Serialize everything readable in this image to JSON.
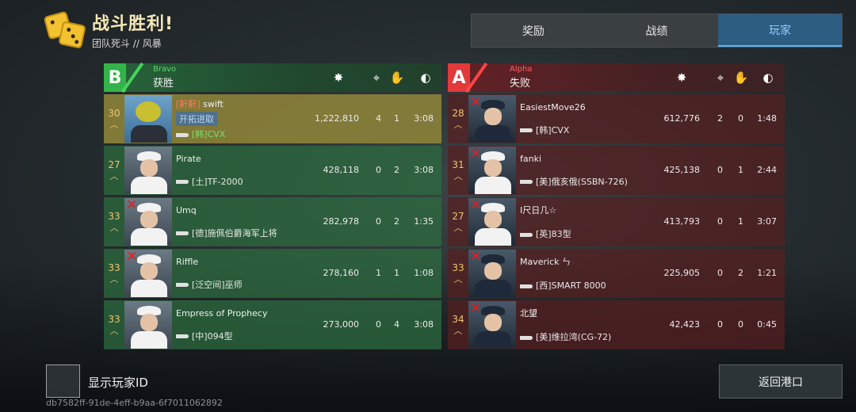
{
  "header": {
    "title": "战斗胜利!",
    "subtitle": "团队死斗 // 风暴"
  },
  "tabs": [
    {
      "label": "奖励",
      "active": false
    },
    {
      "label": "战绩",
      "active": false
    },
    {
      "label": "玩家",
      "active": true
    }
  ],
  "stat_icons": [
    "damage-icon",
    "crosshair-icon",
    "handshake-icon",
    "clock-icon"
  ],
  "bravo": {
    "letter": "B",
    "code": "Bravo",
    "result": "获胜",
    "players": [
      {
        "level": "30",
        "clan": "[鼾鼾]",
        "name": "swift",
        "tag": "开拓进取",
        "ship": "[韩]CVX",
        "damage": "1,222,810",
        "kills": "4",
        "assists": "1",
        "time": "3:08",
        "dead": false,
        "self": true,
        "portrait": "frog"
      },
      {
        "level": "27",
        "clan": "",
        "name": "Pirate",
        "tag": "",
        "ship": "[土]TF-2000",
        "damage": "428,118",
        "kills": "0",
        "assists": "2",
        "time": "3:08",
        "dead": false,
        "self": false,
        "portrait": "light"
      },
      {
        "level": "33",
        "clan": "",
        "name": "Umq",
        "tag": "",
        "ship": "[德]施佩伯爵海军上将",
        "damage": "282,978",
        "kills": "0",
        "assists": "2",
        "time": "1:35",
        "dead": true,
        "self": false,
        "portrait": "light"
      },
      {
        "level": "33",
        "clan": "",
        "name": "Riffle",
        "tag": "",
        "ship": "[泛空间]巫师",
        "damage": "278,160",
        "kills": "1",
        "assists": "1",
        "time": "1:08",
        "dead": true,
        "self": false,
        "portrait": "light"
      },
      {
        "level": "33",
        "clan": "",
        "name": "Empress of Prophecy",
        "tag": "",
        "ship": "[中]094型",
        "damage": "273,000",
        "kills": "0",
        "assists": "4",
        "time": "3:08",
        "dead": false,
        "self": false,
        "portrait": "light"
      }
    ]
  },
  "alpha": {
    "letter": "A",
    "code": "Alpha",
    "result": "失败",
    "players": [
      {
        "level": "28",
        "name": "EasiestMove26",
        "ship": "[韩]CVX",
        "damage": "612,776",
        "kills": "2",
        "assists": "0",
        "time": "1:48",
        "dead": true,
        "portrait": "dark"
      },
      {
        "level": "31",
        "name": "fanki",
        "ship": "[美]俄亥俄(SSBN-726)",
        "damage": "425,138",
        "kills": "0",
        "assists": "1",
        "time": "2:44",
        "dead": true,
        "portrait": "light"
      },
      {
        "level": "27",
        "name": "I尺日几☆",
        "ship": "[英]83型",
        "damage": "413,793",
        "kills": "0",
        "assists": "1",
        "time": "3:07",
        "dead": true,
        "portrait": "light"
      },
      {
        "level": "33",
        "name": "Maverick ㄣ",
        "ship": "[西]SMART 8000",
        "damage": "225,905",
        "kills": "0",
        "assists": "2",
        "time": "1:21",
        "dead": true,
        "portrait": "dark"
      },
      {
        "level": "34",
        "name": "北望",
        "ship": "[美]维拉湾(CG-72)",
        "damage": "42,423",
        "kills": "0",
        "assists": "0",
        "time": "0:45",
        "dead": true,
        "portrait": "dark"
      }
    ]
  },
  "footer": {
    "show_id_label": "显示玩家ID",
    "uuid": "db7582ff-91de-4eff-b9aa-6f7011062892",
    "back_label": "返回港口"
  }
}
